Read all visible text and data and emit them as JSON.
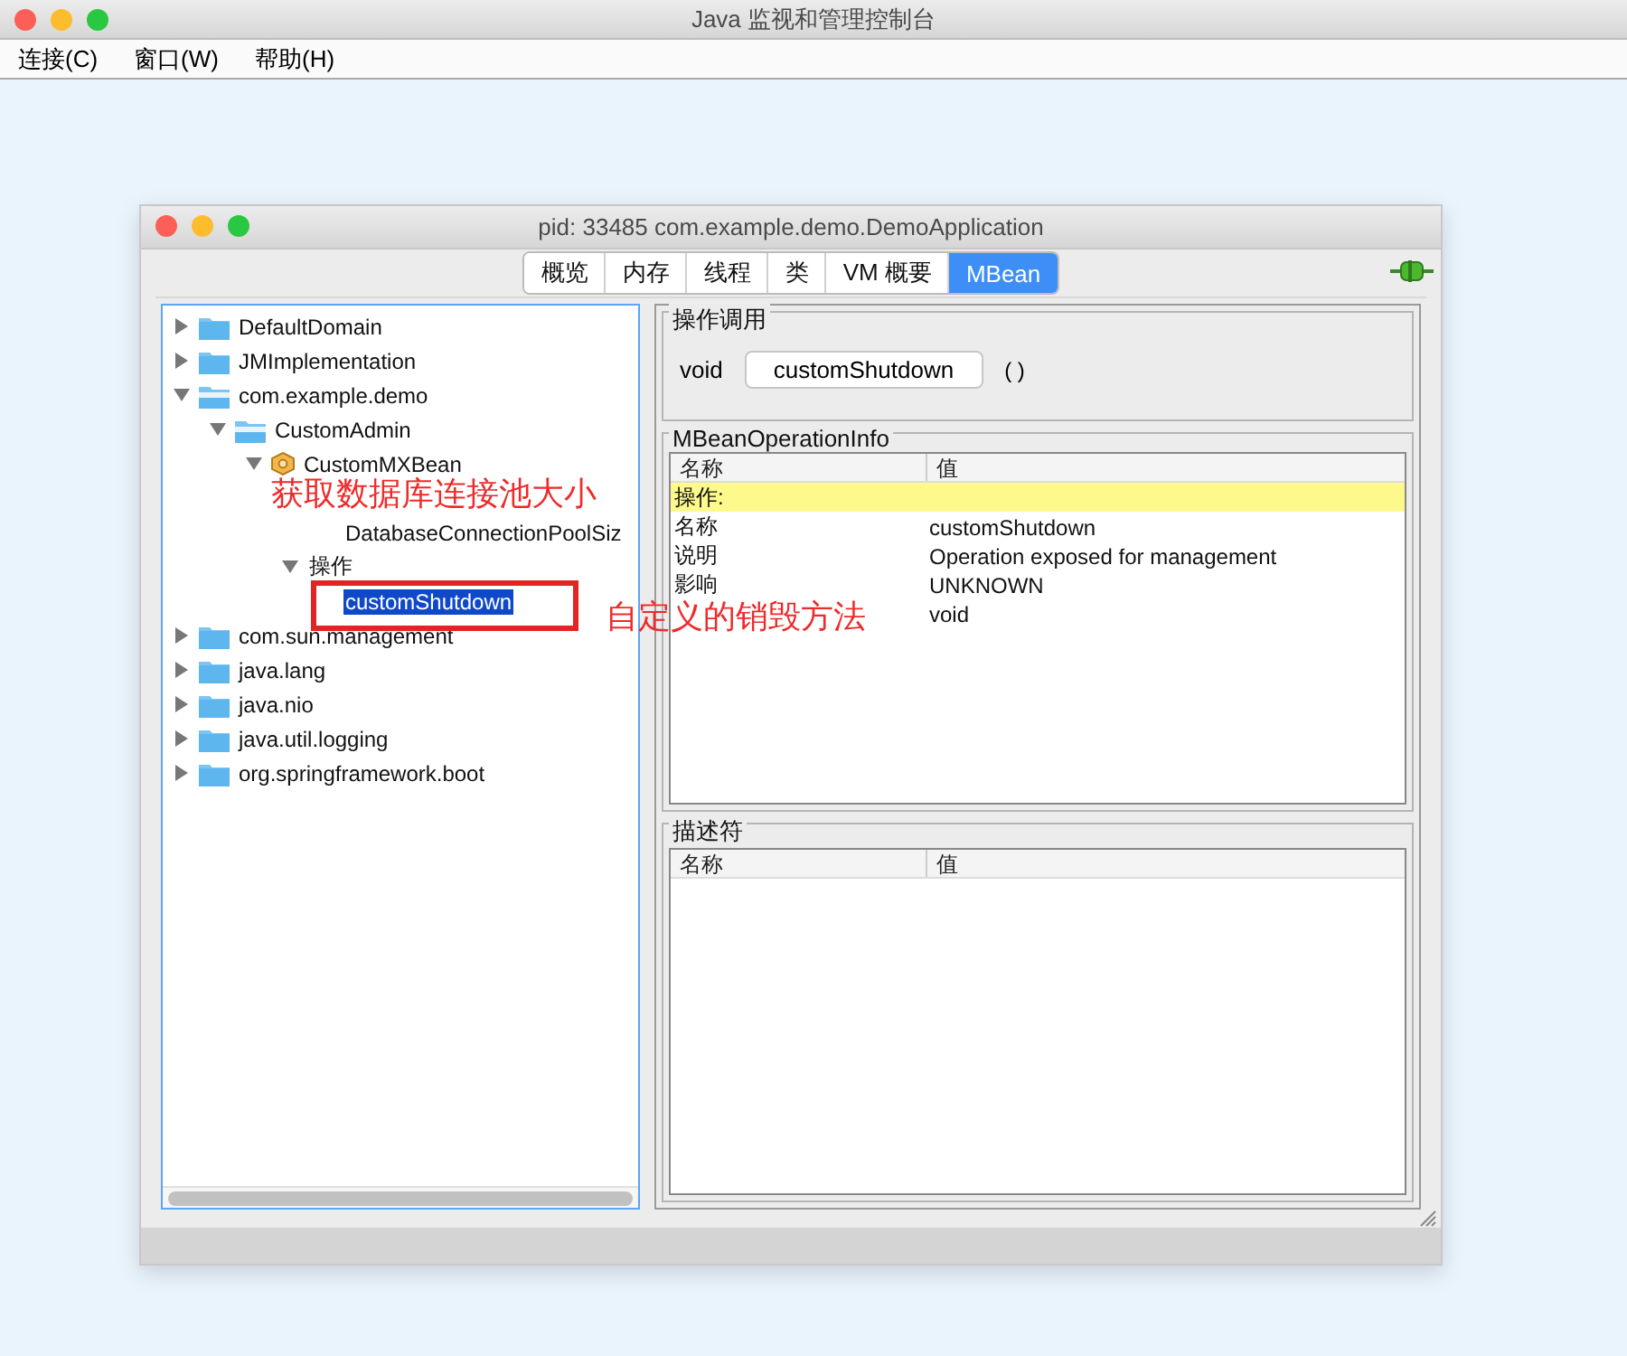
{
  "window": {
    "title": "Java 监视和管理控制台"
  },
  "menu": [
    "连接(C)",
    "窗口(W)",
    "帮助(H)"
  ],
  "inner_window": {
    "title": "pid: 33485 com.example.demo.DemoApplication",
    "tabs": [
      {
        "label": "概览",
        "selected": false
      },
      {
        "label": "内存",
        "selected": false
      },
      {
        "label": "线程",
        "selected": false
      },
      {
        "label": "类",
        "selected": false
      },
      {
        "label": "VM 概要",
        "selected": false
      },
      {
        "label": "MBean",
        "selected": true
      }
    ],
    "tree": [
      {
        "label": "DefaultDomain",
        "kind": "folder",
        "expanded": false,
        "selected": false
      },
      {
        "label": "JMImplementation",
        "kind": "folder",
        "expanded": false,
        "selected": false
      },
      {
        "label": "com.example.demo",
        "kind": "folder",
        "expanded": true,
        "selected": false,
        "children": [
          {
            "label": "CustomAdmin",
            "kind": "folder",
            "expanded": true,
            "selected": false,
            "children": [
              {
                "label": "CustomMXBean",
                "kind": "bean",
                "expanded": true,
                "selected": false,
                "children": [
                  {
                    "kind": "covered",
                    "children": [
                      {
                        "label": "DatabaseConnectionPoolSiz",
                        "kind": "leaf",
                        "selected": false
                      }
                    ]
                  },
                  {
                    "label": "操作",
                    "kind": "group",
                    "expanded": true,
                    "selected": false,
                    "children": [
                      {
                        "label": "customShutdown",
                        "kind": "leaf",
                        "selected": true
                      }
                    ]
                  }
                ]
              }
            ]
          }
        ]
      },
      {
        "label": "com.sun.management",
        "kind": "folder",
        "expanded": false,
        "selected": false
      },
      {
        "label": "java.lang",
        "kind": "folder",
        "expanded": false,
        "selected": false
      },
      {
        "label": "java.nio",
        "kind": "folder",
        "expanded": false,
        "selected": false
      },
      {
        "label": "java.util.logging",
        "kind": "folder",
        "expanded": false,
        "selected": false
      },
      {
        "label": "org.springframework.boot",
        "kind": "folder",
        "expanded": false,
        "selected": false
      }
    ],
    "invocation": {
      "title": "操作调用",
      "return_type": "void",
      "button": "customShutdown",
      "params": "( )"
    },
    "operation_info": {
      "title": "MBeanOperationInfo",
      "columns": [
        "名称",
        "值"
      ],
      "rows": [
        {
          "name": "操作:",
          "highlighted": true
        },
        {
          "name": "名称",
          "value": "customShutdown",
          "highlighted": false
        },
        {
          "name": "说明",
          "value": "Operation exposed for management",
          "highlighted": false
        },
        {
          "name": "影响",
          "value": "UNKNOWN",
          "highlighted": false
        },
        {
          "value": "void",
          "highlighted": false
        }
      ]
    },
    "descriptor": {
      "title": "描述符",
      "columns": [
        "名称",
        "值"
      ]
    }
  },
  "annotations": [
    {
      "kind": "text",
      "text": "获取数据库连接池大小"
    },
    {
      "kind": "box"
    },
    {
      "kind": "text",
      "text": "自定义的销毁方法"
    }
  ]
}
